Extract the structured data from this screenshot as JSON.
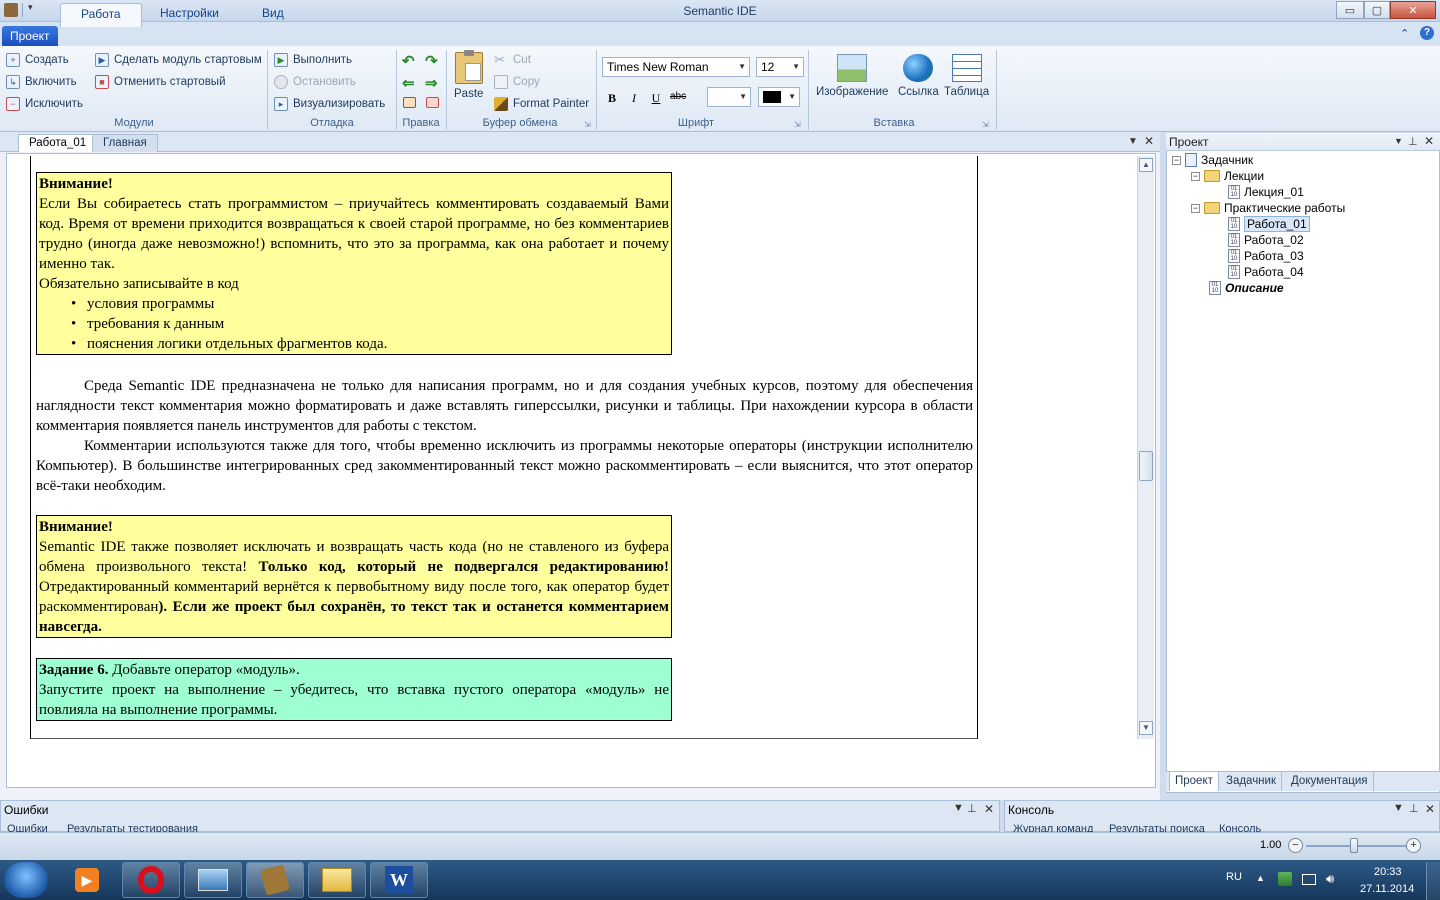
{
  "window": {
    "title": "Semantic IDE",
    "min_glyph": "▭",
    "max_glyph": "▢",
    "close_glyph": "✕",
    "help_glyph": "?",
    "up_glyph": "⌃"
  },
  "ribbon_tabs": {
    "project": "Проект",
    "work": "Работа",
    "settings": "Настройки",
    "view": "Вид"
  },
  "modules": {
    "create": "Создать",
    "include": "Включить",
    "exclude": "Исключить",
    "make_start": "Сделать модуль стартовым",
    "cancel_start": "Отменить стартовый",
    "title": "Модули"
  },
  "debug": {
    "run": "Выполнить",
    "stop": "Остановить",
    "visualize": "Визуализировать",
    "title": "Отладка"
  },
  "edit": {
    "title": "Правка"
  },
  "clipboard": {
    "paste": "Paste",
    "cut": "Cut",
    "copy": "Copy",
    "format_painter": "Format Painter",
    "title": "Буфер обмена"
  },
  "font": {
    "family": "Times New Roman",
    "size": "12",
    "bold": "B",
    "italic": "I",
    "underline": "U",
    "strike": "abc",
    "title": "Шрифт"
  },
  "insert": {
    "image": "Изображение",
    "link": "Ссылка",
    "table": "Таблица",
    "title": "Вставка"
  },
  "doc_tabs": {
    "tab1": "Работа_01",
    "tab2": "Главная"
  },
  "document": {
    "note1": {
      "heading": "Внимание!",
      "text": "Если Вы собираетесь стать программистом – приучайтесь комментировать создаваемый Вами код. Время от времени приходится возвращаться к своей старой программе, но без комментариев трудно (иногда даже невозможно!) вспомнить, что это за программа, как она работает и почему именно так.",
      "list_intro": "Обязательно записывайте в код",
      "items": [
        "условия программы",
        "требования к данным",
        "пояснения логики отдельных фрагментов кода."
      ]
    },
    "para1": "Среда Semantic IDE предназначена не только для написания программ, но и для создания учебных курсов, поэтому для обеспечения наглядности текст комментария можно форматировать и даже вставлять гиперссылки, рисунки и таблицы. При нахождении курсора в области комментария появляется панель инструментов для работы с текстом.",
    "para2": "Комментарии используются также для того, чтобы временно исключить из программы некоторые операторы (инструкции исполнителю Компьютер). В большинстве интегрированных сред закомментированный текст можно раскомментировать – если выяснится, что этот оператор всё-таки необходим.",
    "note2": {
      "heading": "Внимание!",
      "t1": "Semantic IDE также позволяет исключать и возвращать часть кода (но не ставленого из буфера обмена произвольного текста! ",
      "b1": "Только код, который не подвергался редактированию!",
      "t2": " Отредактированный комментарий вернётся к первобытному виду после того, как оператор будет раскомментирован",
      "b2": "). Если же проект был сохранён, то текст так и останется комментарием навсегда."
    },
    "task": {
      "label": "Задание 6.",
      "text1": " Добавьте оператор «модуль».",
      "text2": "Запустите проект на выполнение – убедитесь, что вставка пустого оператора «модуль» не повлияла на выполнение программы."
    }
  },
  "project_panel": {
    "title": "Проект",
    "root": "Задачник",
    "lectures": "Лекции",
    "lecture1": "Лекция_01",
    "practicals": "Практические работы",
    "works": [
      "Работа_01",
      "Работа_02",
      "Работа_03",
      "Работа_04"
    ],
    "description": "Описание",
    "tabs": [
      "Проект",
      "Задачник",
      "Документация"
    ]
  },
  "errors_panel": {
    "title": "Ошибки",
    "tabs": [
      "Ошибки",
      "Результаты тестирования"
    ]
  },
  "console_panel": {
    "title": "Консоль",
    "tabs": [
      "Журнал команд",
      "Результаты поиска",
      "Консоль"
    ]
  },
  "status": {
    "zoom": "1.00"
  },
  "tray": {
    "lang": "RU",
    "time": "20:33",
    "date": "27.11.2014"
  }
}
